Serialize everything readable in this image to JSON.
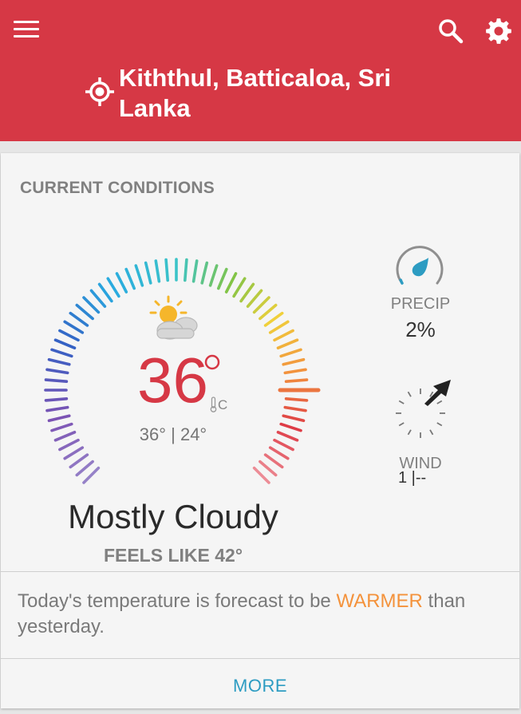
{
  "header": {
    "location": "Kiththul, Batticaloa, Sri Lanka",
    "icons": [
      "menu-icon",
      "search-icon",
      "gear-icon",
      "location-crosshair-icon"
    ],
    "background_color": "#d63845"
  },
  "current_conditions": {
    "title": "CURRENT CONDITIONS",
    "temperature": "36",
    "unit": "C",
    "high_low": "36° | 24°",
    "condition": "Mostly Cloudy",
    "feels_like": "FEELS LIKE 42°",
    "weather_icon": "partly-cloudy-sun-icon",
    "temperature_color": "#d63845"
  },
  "precip": {
    "label": "PRECIP",
    "value": "2%",
    "fraction": 0.02,
    "color": "#2d9cc2"
  },
  "wind": {
    "label": "WIND",
    "value": "1 |--"
  },
  "forecast": {
    "text_before": "Today's temperature is forecast to be ",
    "highlight": "WARMER",
    "text_after": " than yesterday.",
    "highlight_color": "#f4923b"
  },
  "footer": {
    "more_label": "MORE",
    "link_color": "#2d9cc2"
  }
}
